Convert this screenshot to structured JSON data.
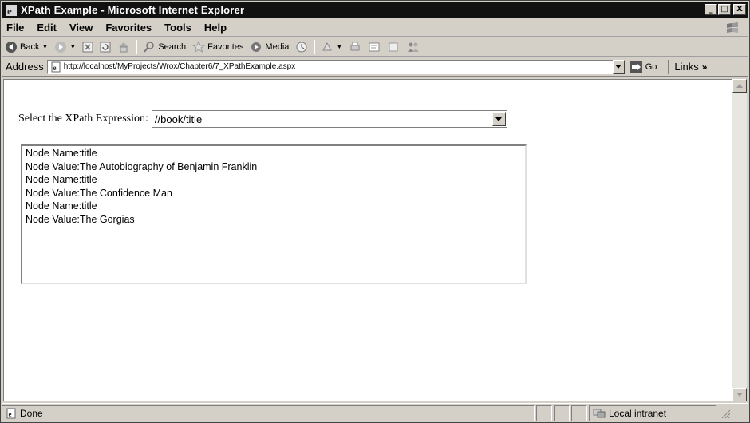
{
  "window": {
    "title": "XPath Example - Microsoft Internet Explorer",
    "controls": [
      "_",
      "□",
      "X"
    ]
  },
  "menu": {
    "items": [
      "File",
      "Edit",
      "View",
      "Favorites",
      "Tools",
      "Help"
    ]
  },
  "toolbar": {
    "back": "Back",
    "search": "Search",
    "favorites": "Favorites",
    "media": "Media"
  },
  "address": {
    "label": "Address",
    "url": "http://localhost/MyProjects/Wrox/Chapter6/7_XPathExample.aspx",
    "go": "Go",
    "links": "Links",
    "links_chevron": "»"
  },
  "page": {
    "select_label": "Select the XPath Expression:",
    "select_value": "//book/title",
    "output_lines": [
      "Node Name:title",
      "Node Value:The Autobiography of Benjamin Franklin",
      "Node Name:title",
      "Node Value:The Confidence Man",
      "Node Name:title",
      "Node Value:The Gorgias"
    ]
  },
  "status": {
    "text": "Done",
    "zone": "Local intranet"
  }
}
